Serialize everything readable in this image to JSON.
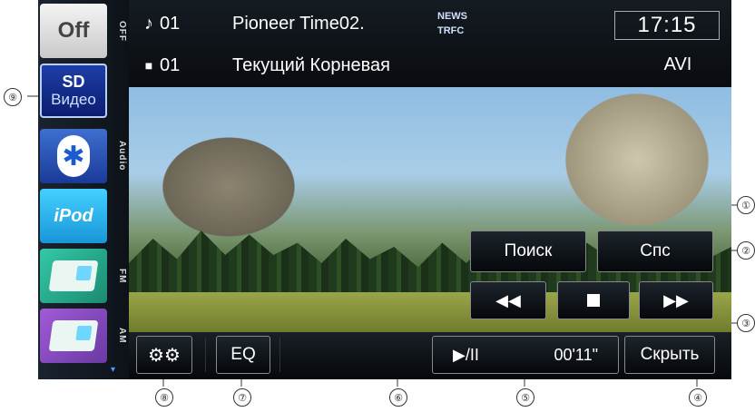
{
  "sidebar": {
    "off_label": "Off",
    "off_side_label": "OFF",
    "sd_label_line1": "SD",
    "sd_label_line2": "Видео",
    "audio_side_label": "Audio",
    "ipod_label": "iPod",
    "fm_side_label": "FM",
    "am_side_label": "AM",
    "scroll_down_icon": "▾"
  },
  "header": {
    "track_icon": "♪",
    "track_number": "01",
    "track_title": "Pioneer Time02.",
    "folder_icon": "■",
    "folder_number": "01",
    "folder_name": "Текущий Корневая",
    "news_label": "NEWS",
    "trfc_label": "TRFC",
    "clock": "17:15",
    "format": "AVI"
  },
  "controls": {
    "search_label": "Поиск",
    "list_label": "Спс",
    "prev_icon": "◀◀",
    "stop_icon": "stop",
    "next_icon": "▶▶",
    "settings_icon": "⚙⚙",
    "eq_label": "EQ",
    "play_pause_label": "▶/II",
    "elapsed_time": "00'11\"",
    "hide_label": "Скрыть"
  },
  "callouts": [
    "①",
    "②",
    "③",
    "④",
    "⑤",
    "⑥",
    "⑦",
    "⑧",
    "⑨"
  ],
  "colors": {
    "sd_button": "#1e3ea8",
    "ipod_button": "#44d0ff",
    "fm_button": "#33c9a7",
    "am_button": "#a05bd6",
    "screen_background": "#000000"
  }
}
